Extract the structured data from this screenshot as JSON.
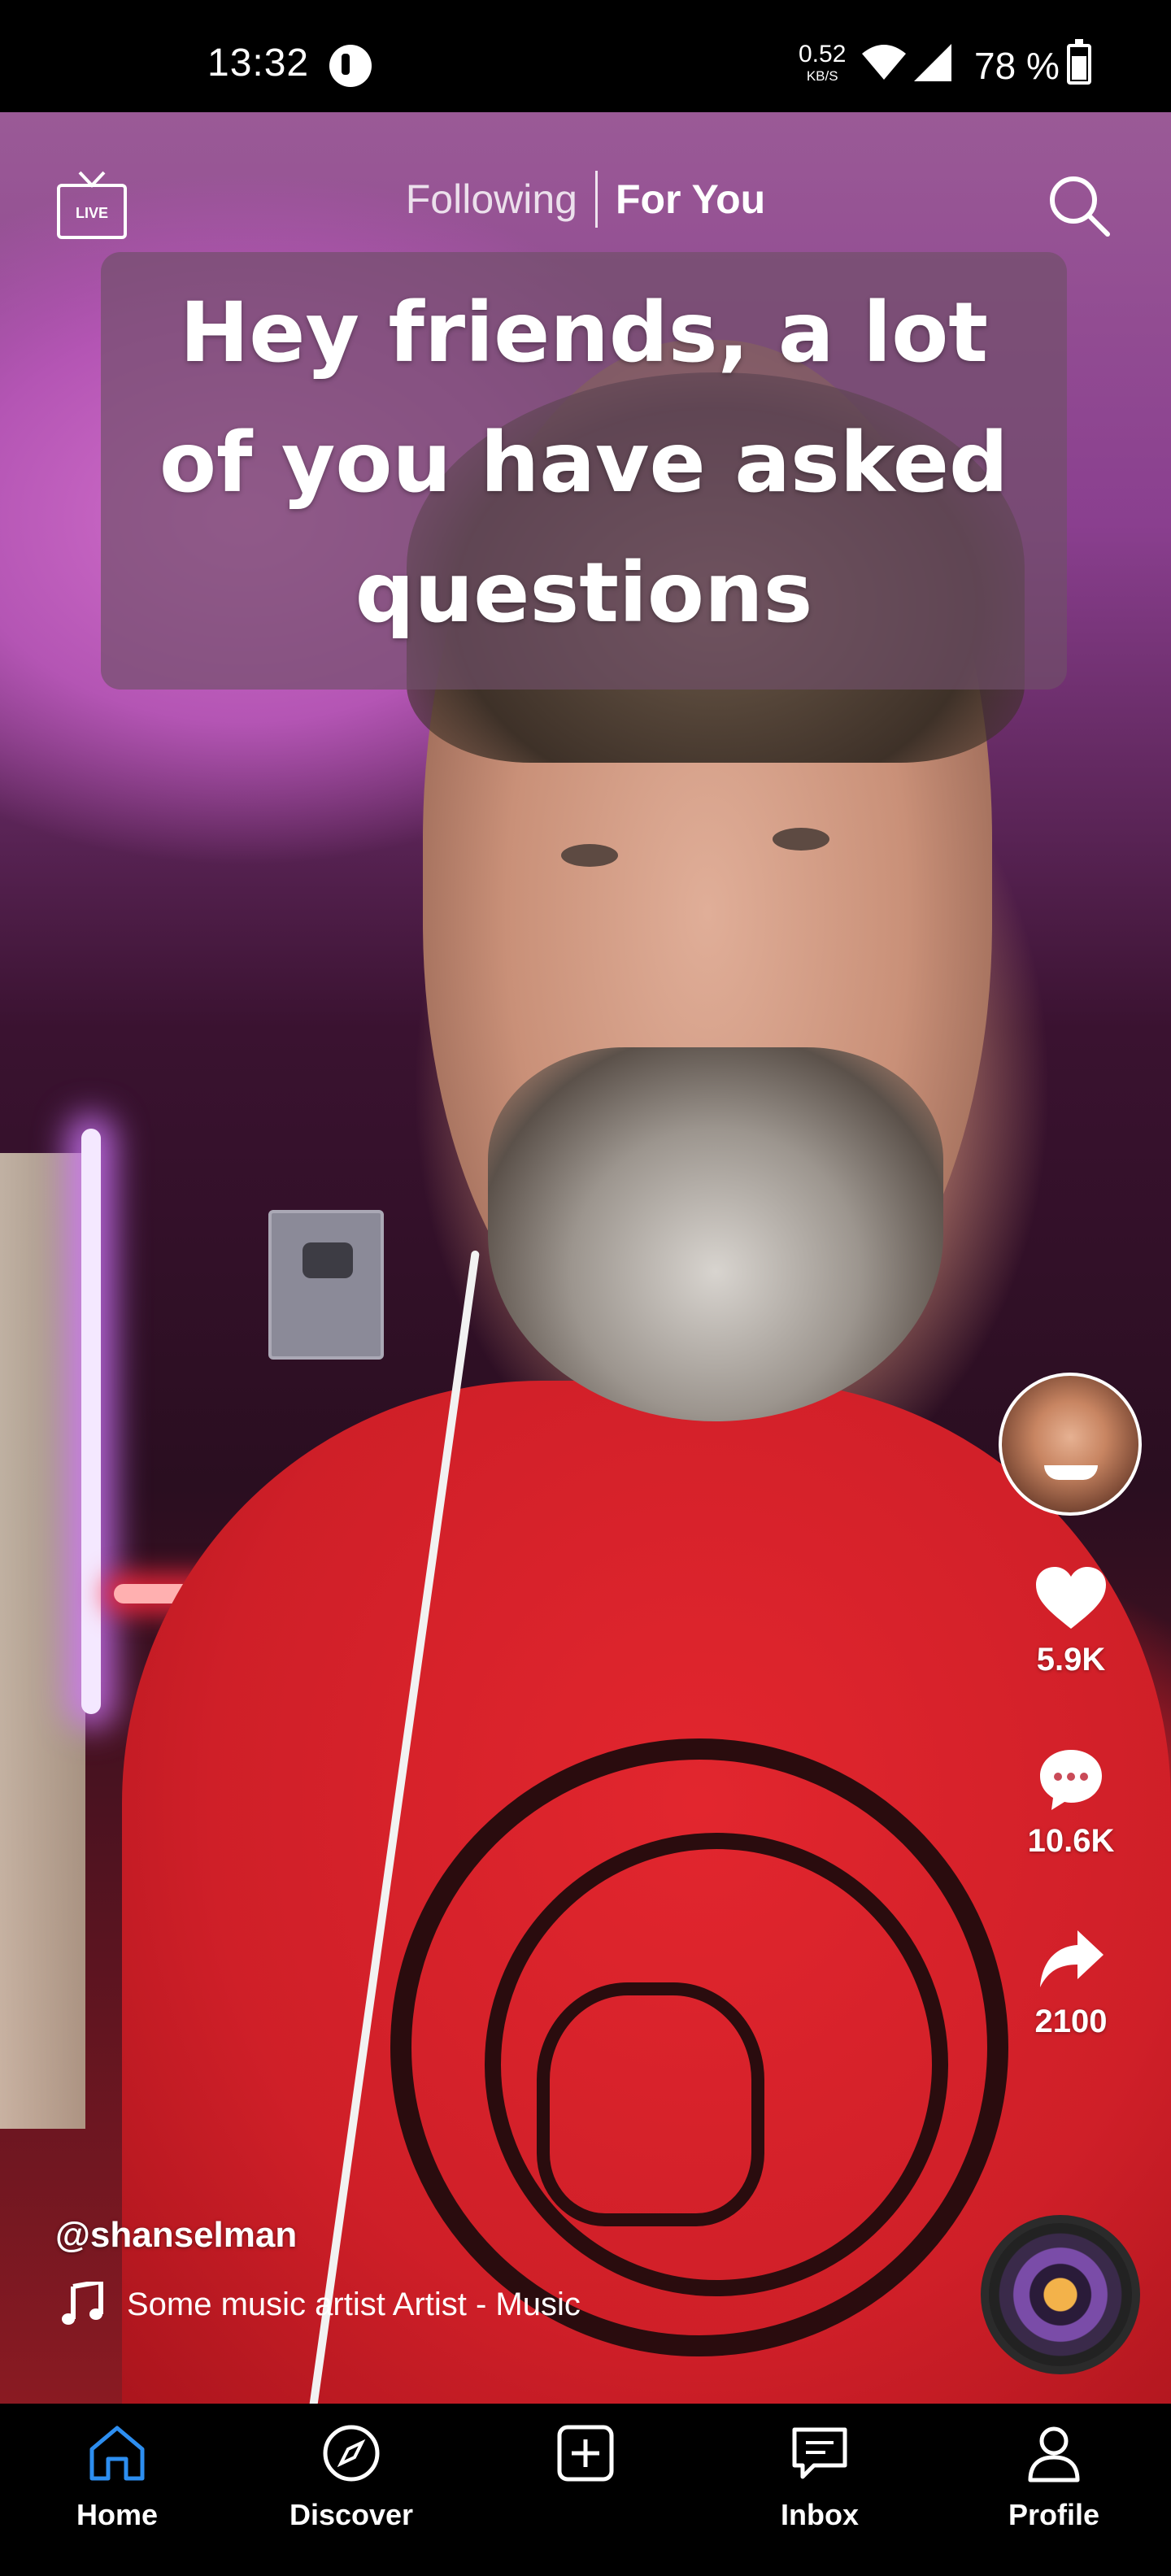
{
  "status_bar": {
    "time": "13:32",
    "network_speed_value": "0.52",
    "network_speed_unit": "KB/S",
    "battery": "78 %"
  },
  "top_nav": {
    "live_label": "LIVE",
    "tabs": [
      {
        "label": "Following",
        "active": false
      },
      {
        "label": "For You",
        "active": true
      }
    ]
  },
  "video": {
    "caption": "Hey friends, a lot of you have asked questions",
    "author": "@shanselman",
    "music": "Some music artist Artist - Music"
  },
  "actions": {
    "likes": "5.9K",
    "comments": "10.6K",
    "shares": "2100"
  },
  "bottom_nav": {
    "items": [
      {
        "label": "Home",
        "icon": "home-icon",
        "active": true
      },
      {
        "label": "Discover",
        "icon": "compass-icon",
        "active": false
      },
      {
        "label": "",
        "icon": "plus-square-icon",
        "active": false
      },
      {
        "label": "Inbox",
        "icon": "message-icon",
        "active": false
      },
      {
        "label": "Profile",
        "icon": "user-icon",
        "active": false
      }
    ]
  },
  "colors": {
    "active_nav": "#2d8ef0",
    "shirt_red": "#d8232b",
    "background": "#000000"
  }
}
